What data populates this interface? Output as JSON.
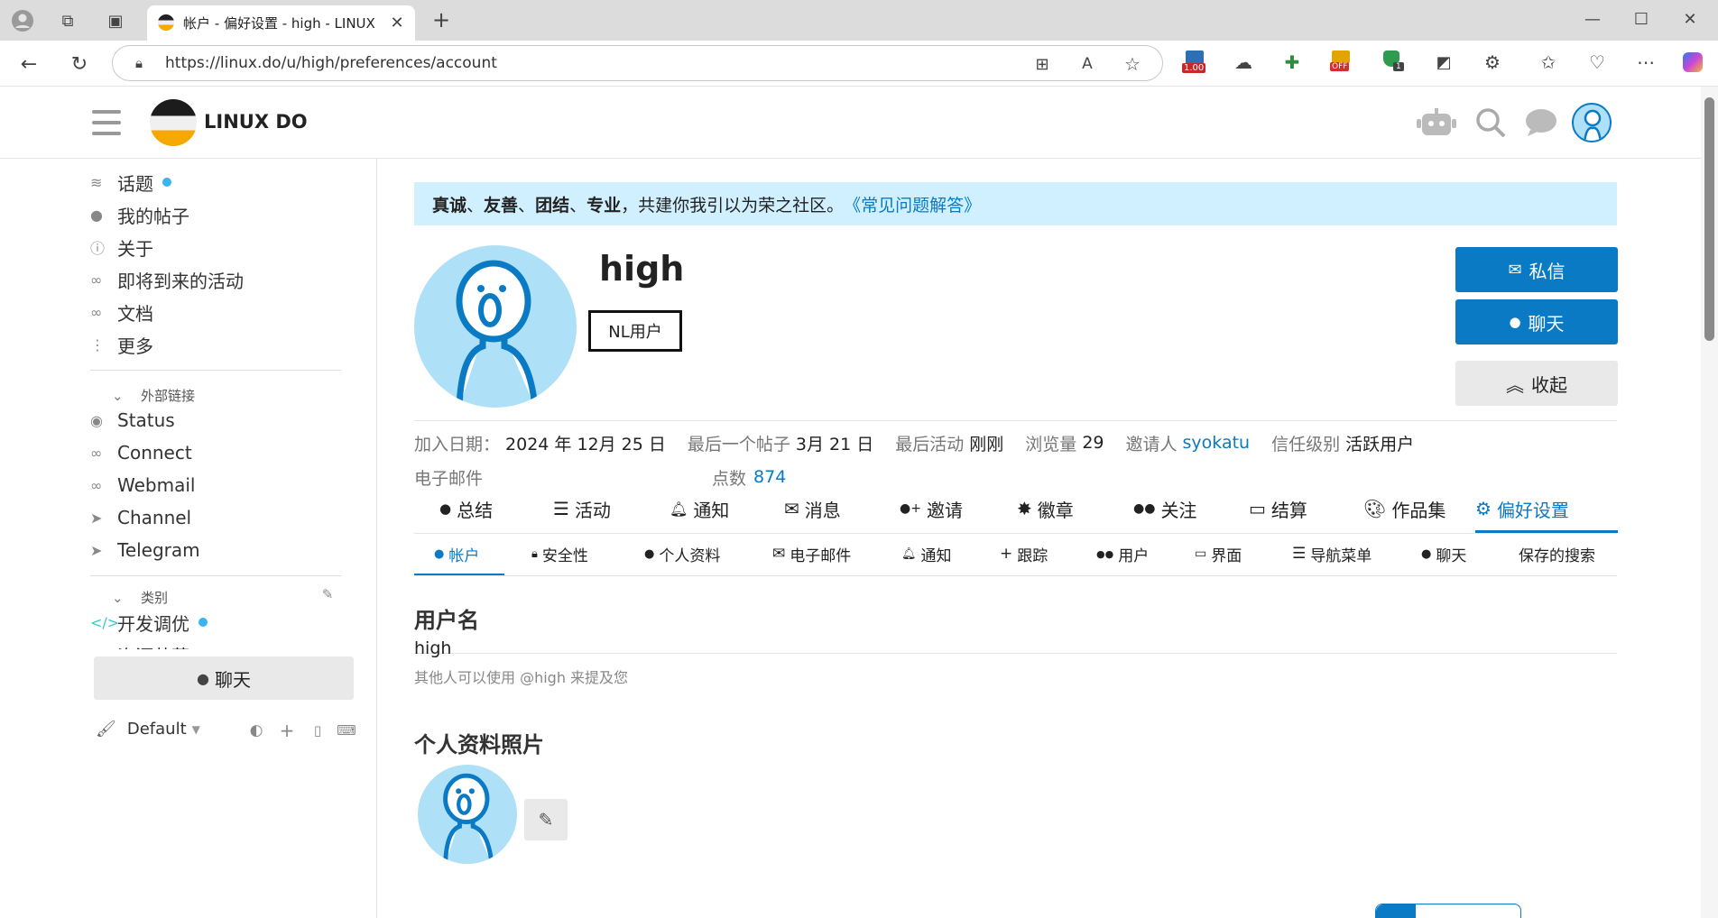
{
  "browser": {
    "tab_title": "帐户 - 偏好设置 - high - LINUX DO",
    "url": "https://linux.do/u/high/preferences/account",
    "ext_badge_1": "1.00",
    "ext_badge_2": "OFF",
    "ext_badge_3": "1"
  },
  "header": {
    "site_name": "LINUX DO"
  },
  "sidebar": {
    "items": [
      {
        "label": "话题"
      },
      {
        "label": "我的帖子"
      },
      {
        "label": "关于"
      },
      {
        "label": "即将到来的活动"
      },
      {
        "label": "文档"
      },
      {
        "label": "更多"
      }
    ],
    "external_title": "外部链接",
    "external": [
      {
        "label": "Status"
      },
      {
        "label": "Connect"
      },
      {
        "label": "Webmail"
      },
      {
        "label": "Channel"
      },
      {
        "label": "Telegram"
      }
    ],
    "categories_title": "类别",
    "categories": [
      {
        "label": "开发调优"
      },
      {
        "label": "资源荟萃"
      }
    ],
    "chat_button": "聊天",
    "theme_label": "Default"
  },
  "banner": {
    "b1": "真诚",
    "sep1": "、",
    "b2": "友善",
    "sep2": "、",
    "b3": "团结",
    "sep3": "、",
    "b4": "专业",
    "rest": "，共建你我引以为荣之社区。",
    "link": "《常见问题解答》"
  },
  "profile": {
    "username": "high",
    "title_badge": "NL用户",
    "message_button": "私信",
    "chat_button": "聊天",
    "collapse_button": "收起",
    "join_label": "加入日期：",
    "join_value": "2024 年 12月 25 日",
    "last_post_label": "最后一个帖子",
    "last_post_value": "3月 21 日",
    "last_active_label": "最后活动",
    "last_active_value": "刚刚",
    "views_label": "浏览量",
    "views_value": "29",
    "invited_by_label": "邀请人",
    "invited_by_value": "syokatu",
    "trust_label": "信任级别",
    "trust_value": "活跃用户",
    "email_label": "电子邮件",
    "points_label": "点数",
    "points_value": "874"
  },
  "nav_primary": [
    {
      "label": "总结",
      "icon": "user-icon"
    },
    {
      "label": "活动",
      "icon": "list-icon"
    },
    {
      "label": "通知",
      "icon": "bell-icon"
    },
    {
      "label": "消息",
      "icon": "envelope-icon"
    },
    {
      "label": "邀请",
      "icon": "user-plus-icon"
    },
    {
      "label": "徽章",
      "icon": "certificate-icon"
    },
    {
      "label": "关注",
      "icon": "users-icon"
    },
    {
      "label": "结算",
      "icon": "card-icon"
    },
    {
      "label": "作品集",
      "icon": "palette-icon"
    },
    {
      "label": "偏好设置",
      "icon": "gear-icon"
    }
  ],
  "nav_secondary": [
    {
      "label": "帐户"
    },
    {
      "label": "安全性"
    },
    {
      "label": "个人资料"
    },
    {
      "label": "电子邮件"
    },
    {
      "label": "通知"
    },
    {
      "label": "跟踪"
    },
    {
      "label": "用户"
    },
    {
      "label": "界面"
    },
    {
      "label": "导航菜单"
    },
    {
      "label": "聊天"
    },
    {
      "label": "保存的搜索"
    }
  ],
  "account": {
    "username_heading": "用户名",
    "username_value": "high",
    "username_help": "其他人可以使用 @high 来提及您",
    "photo_heading": "个人资料照片"
  },
  "colors": {
    "accent": "#0a7ac4",
    "banner_bg": "#d1f0ff",
    "unread_dot": "#3ab4f2"
  }
}
